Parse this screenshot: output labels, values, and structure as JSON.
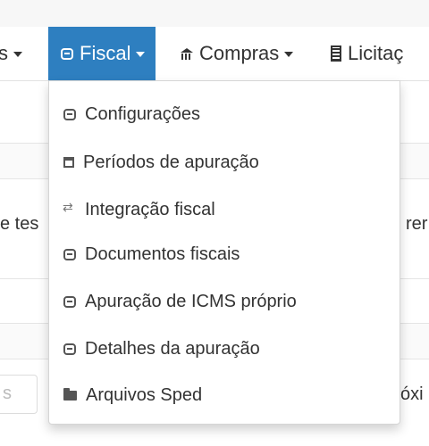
{
  "navbar": {
    "items": [
      {
        "label": "s",
        "active": false
      },
      {
        "label": "Fiscal",
        "active": true
      },
      {
        "label": "Compras",
        "active": false
      },
      {
        "label": "Licitaç",
        "active": false
      }
    ]
  },
  "background": {
    "left_text": "e tes",
    "right_text": "rer",
    "input_placeholder": "s",
    "right_text_2": "óxi"
  },
  "fiscal_menu": {
    "items": [
      {
        "label": "Configurações",
        "icon": "coins-icon"
      },
      {
        "label": "Períodos de apuração",
        "icon": "calendar-icon"
      },
      {
        "label": "Integração fiscal",
        "icon": "exchange-icon"
      },
      {
        "label": "Documentos fiscais",
        "icon": "coins-icon"
      },
      {
        "label": "Apuração de ICMS próprio",
        "icon": "coins-icon"
      },
      {
        "label": "Detalhes da apuração",
        "icon": "coins-icon"
      },
      {
        "label": "Arquivos Sped",
        "icon": "folder-icon"
      }
    ]
  },
  "colors": {
    "accent": "#2e7fc0",
    "text": "#333333",
    "icon": "#555555"
  }
}
